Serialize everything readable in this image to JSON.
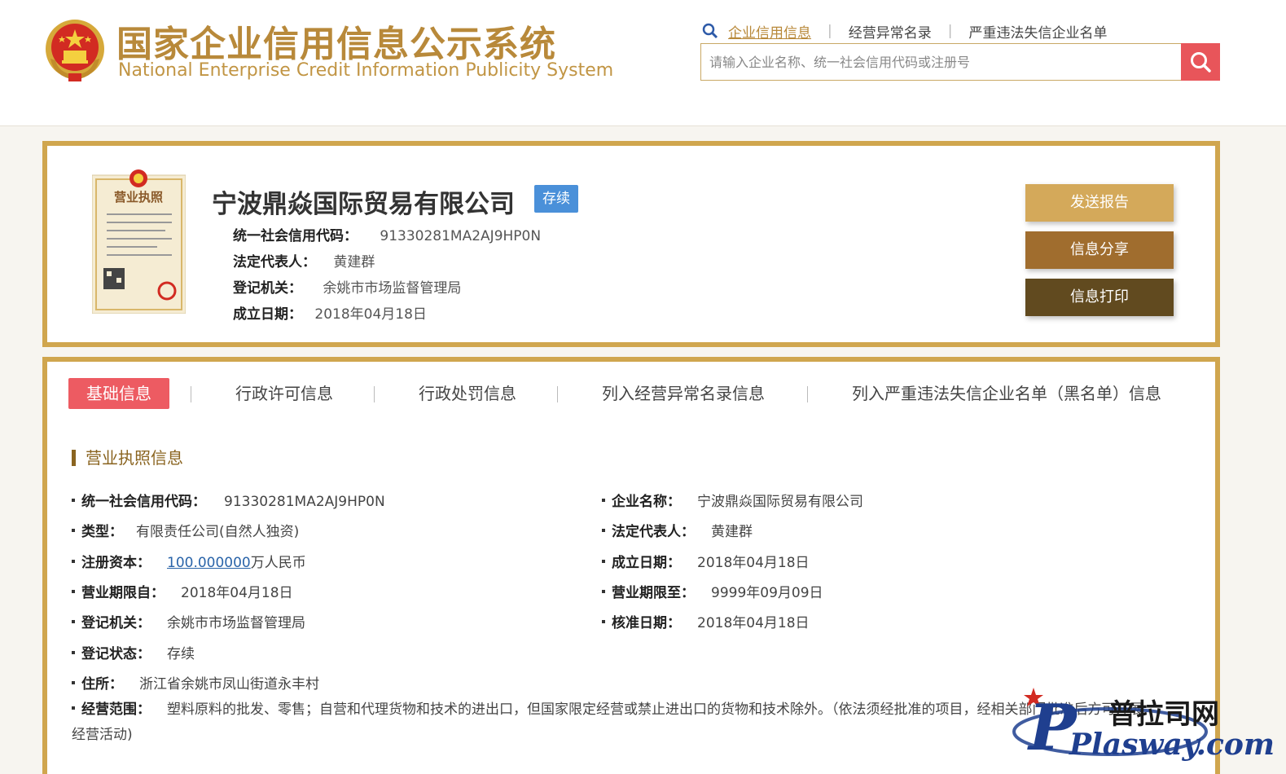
{
  "header": {
    "title_cn": "国家企业信用信息公示系统",
    "title_en": "National Enterprise Credit Information Publicity System",
    "links": [
      "企业信用信息",
      "经营异常名录",
      "严重违法失信企业名单"
    ],
    "search_placeholder": "请输入企业名称、统一社会信用代码或注册号"
  },
  "company": {
    "name": "宁波鼎焱国际贸易有限公司",
    "status": "存续",
    "credit_code_label": "统一社会信用代码：",
    "credit_code": "91330281MA2AJ9HP0N",
    "legal_rep_label": "法定代表人：",
    "legal_rep": "黄建群",
    "registry_label": "登记机关：",
    "registry": "余姚市市场监督管理局",
    "founded_label": "成立日期：",
    "founded": "2018年04月18日",
    "license_caption": "营业执照"
  },
  "actions": {
    "send_report": "发送报告",
    "share": "信息分享",
    "print": "信息打印"
  },
  "tabs": [
    "基础信息",
    "行政许可信息",
    "行政处罚信息",
    "列入经营异常名录信息",
    "列入严重违法失信企业名单（黑名单）信息"
  ],
  "section": {
    "title": "营业执照信息",
    "fields": {
      "credit_code": {
        "label": "统一社会信用代码：",
        "value": "91330281MA2AJ9HP0N"
      },
      "name": {
        "label": "企业名称：",
        "value": "宁波鼎焱国际贸易有限公司"
      },
      "type": {
        "label": "类型：",
        "value": "有限责任公司(自然人独资)"
      },
      "legal_rep": {
        "label": "法定代表人：",
        "value": "黄建群"
      },
      "capital": {
        "label": "注册资本：",
        "value": "100.000000",
        "unit": "万人民币"
      },
      "founded": {
        "label": "成立日期：",
        "value": "2018年04月18日"
      },
      "term_from": {
        "label": "营业期限自：",
        "value": "2018年04月18日"
      },
      "term_to": {
        "label": "营业期限至：",
        "value": "9999年09月09日"
      },
      "registry": {
        "label": "登记机关：",
        "value": "余姚市市场监督管理局"
      },
      "approved": {
        "label": "核准日期：",
        "value": "2018年04月18日"
      },
      "reg_status": {
        "label": "登记状态：",
        "value": "存续"
      },
      "address": {
        "label": "住所：",
        "value": "浙江省余姚市凤山街道永丰村"
      },
      "scope": {
        "label": "经营范围：",
        "value": "塑料原料的批发、零售；自营和代理货物和技术的进出口，但国家限定经营或禁止进出口的货物和技术除外。（依法须经批准的项目，经相关部门批准后方可开展经营活动)"
      }
    }
  },
  "watermark": {
    "cn": "普拉司网",
    "en": "Plasway.com"
  }
}
